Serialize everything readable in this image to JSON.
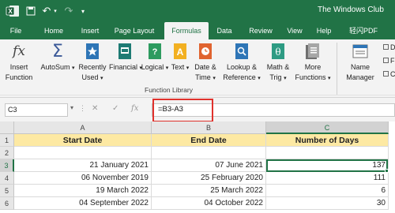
{
  "window": {
    "title": "The Windows Club"
  },
  "tabs": [
    {
      "label": "File"
    },
    {
      "label": "Home"
    },
    {
      "label": "Insert"
    },
    {
      "label": "Page Layout"
    },
    {
      "label": "Formulas"
    },
    {
      "label": "Data"
    },
    {
      "label": "Review"
    },
    {
      "label": "View"
    },
    {
      "label": "Help"
    },
    {
      "label": "轻闪PDF"
    }
  ],
  "ribbon": {
    "group_label": "Function Library",
    "buttons": [
      {
        "line1": "Insert",
        "line2": "Function"
      },
      {
        "line1": "AutoSum",
        "line2": ""
      },
      {
        "line1": "Recently",
        "line2": "Used"
      },
      {
        "line1": "Financial",
        "line2": ""
      },
      {
        "line1": "Logical",
        "line2": ""
      },
      {
        "line1": "Text",
        "line2": ""
      },
      {
        "line1": "Date &",
        "line2": "Time"
      },
      {
        "line1": "Lookup &",
        "line2": "Reference"
      },
      {
        "line1": "Math &",
        "line2": "Trig"
      },
      {
        "line1": "More",
        "line2": "Functions"
      },
      {
        "line1": "Name",
        "line2": "Manager"
      }
    ],
    "defined_names_partial": [
      "D",
      "F",
      "C"
    ]
  },
  "formula_bar": {
    "name_box": "C3",
    "formula": "=B3-A3"
  },
  "sheet": {
    "columns": [
      "A",
      "B",
      "C"
    ],
    "rows": [
      "1",
      "2",
      "3",
      "4",
      "5",
      "6"
    ],
    "headers": [
      "Start Date",
      "End Date",
      "Number of Days"
    ],
    "data": [
      [
        "21 January 2021",
        "07 June 2021",
        "137"
      ],
      [
        "06 November 2019",
        "25 February 2020",
        "111"
      ],
      [
        "19 March 2022",
        "25 March 2022",
        "6"
      ],
      [
        "04 September 2022",
        "04 October 2022",
        "30"
      ]
    ],
    "selected_cell": "C3"
  },
  "colors": {
    "excel_green": "#217346",
    "header_fill": "#fde9a3",
    "highlight_red": "#e0322d"
  }
}
